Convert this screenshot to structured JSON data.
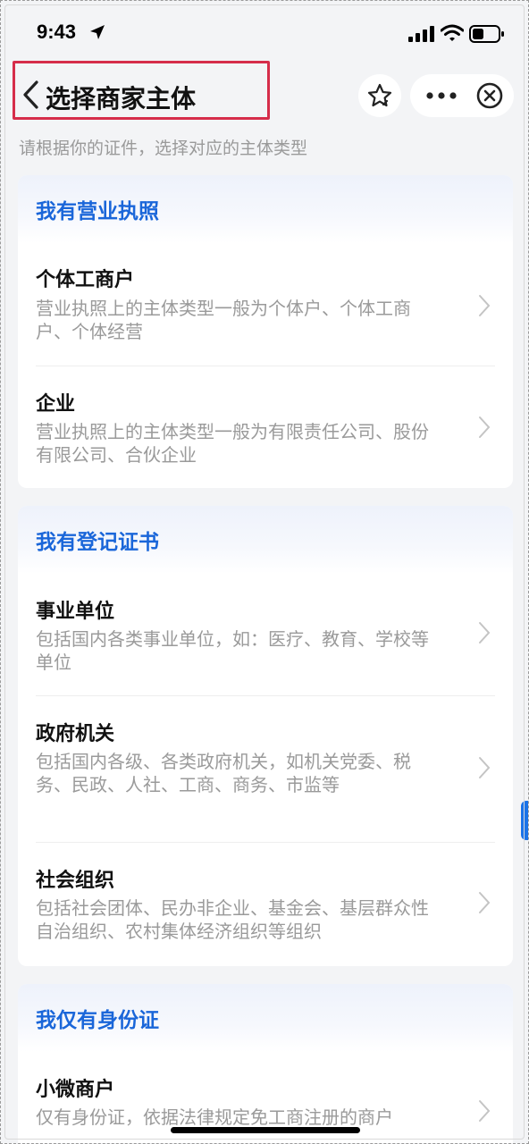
{
  "status_bar": {
    "time": "9:43"
  },
  "nav": {
    "title": "选择商家主体"
  },
  "subtitle": "请根据你的证件，选择对应的主体类型",
  "sections": [
    {
      "header": "我有营业执照",
      "items": [
        {
          "title": "个体工商户",
          "desc": "营业执照上的主体类型一般为个体户、个体工商户、个体经营"
        },
        {
          "title": "企业",
          "desc": "营业执照上的主体类型一般为有限责任公司、股份有限公司、合伙企业"
        }
      ]
    },
    {
      "header": "我有登记证书",
      "items": [
        {
          "title": "事业单位",
          "desc": "包括国内各类事业单位，如：医疗、教育、学校等单位"
        },
        {
          "title": "政府机关",
          "desc": "包括国内各级、各类政府机关，如机关党委、税务、民政、人社、工商、商务、市监等"
        },
        {
          "title": "社会组织",
          "desc": "包括社会团体、民办非企业、基金会、基层群众性自治组织、农村集体经济组织等组织"
        }
      ]
    },
    {
      "header": "我仅有身份证",
      "items": [
        {
          "title": "小微商户",
          "desc": "仅有身份证，依据法律规定免工商注册的商户"
        }
      ]
    }
  ],
  "colors": {
    "accent": "#1a66d9",
    "highlight": "#d62d4a",
    "muted_text": "#9a9a9a"
  },
  "icons": [
    "location-arrow-icon",
    "signal-icon",
    "wifi-icon",
    "battery-icon",
    "back-chevron-icon",
    "star-icon",
    "more-icon",
    "close-circle-icon",
    "chevron-right-icon"
  ]
}
